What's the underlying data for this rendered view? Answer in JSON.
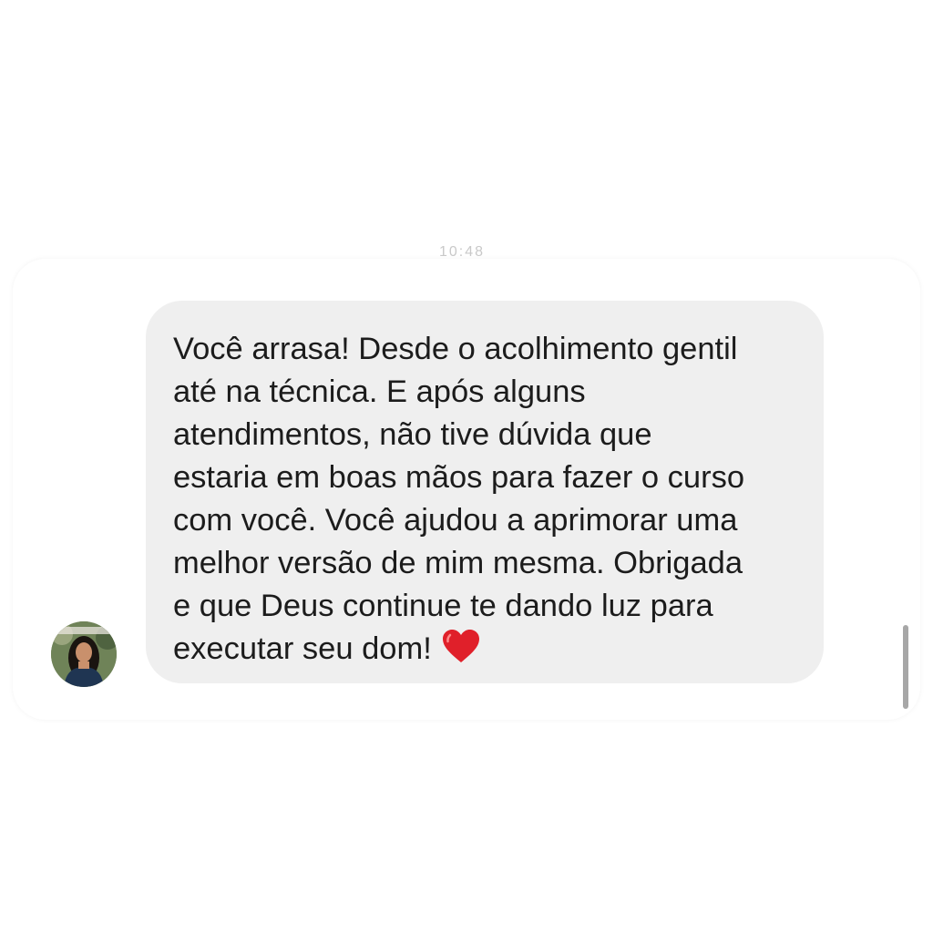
{
  "header": {
    "timestamp": "10:48"
  },
  "message": {
    "text": "Você arrasa! Desde o acolhimento gentil\naté na técnica. E após alguns\natendimentos, não tive dúvida que\nestaria em boas mãos para fazer o curso\ncom você. Você ajudou a aprimorar uma\nmelhor versão de mim mesma. Obrigada\ne que Deus continue te dando luz para\nexecutar seu dom!",
    "emoji": "heart-icon",
    "bubble_color": "#efefef",
    "text_color": "#1c1c1c",
    "heart_color": "#e0202a"
  },
  "sender": {
    "avatar": "avatar"
  }
}
